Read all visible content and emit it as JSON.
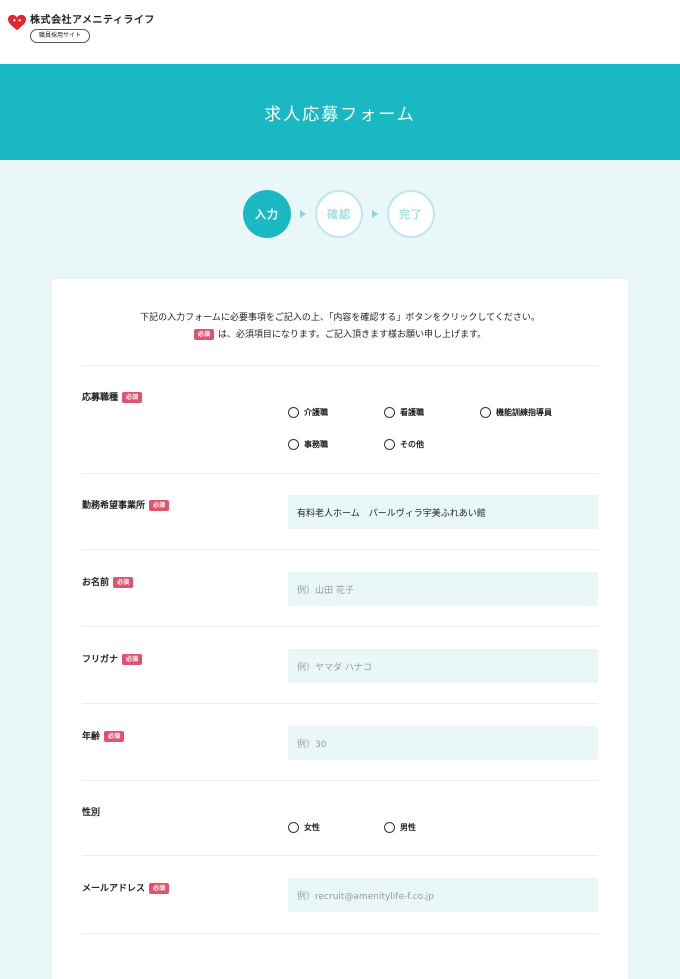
{
  "header": {
    "company_name": "株式会社アメニティライフ",
    "site_label": "職員採用サイト",
    "logo_icon": "heart-logo-icon",
    "logo_color": "#e0262f"
  },
  "banner": {
    "title": "求人応募フォーム",
    "color": "#1ab8c2"
  },
  "steps": [
    {
      "label": "入力",
      "active": true
    },
    {
      "label": "確認",
      "active": false
    },
    {
      "label": "完了",
      "active": false
    }
  ],
  "intro": {
    "line1": "下記の入力フォームに必要事項をご記入の上、「内容を確認する」ボタンをクリックしてください。",
    "line2": "は、必須項目になります。ご記入頂きます様お願い申し上げます。"
  },
  "required_badge": "必須",
  "form": {
    "job_type": {
      "label": "応募職種",
      "options": [
        "介護職",
        "看護職",
        "機能訓練指導員",
        "事務職",
        "その他"
      ]
    },
    "workplace": {
      "label": "勤務希望事業所",
      "value": "有料老人ホーム　パールヴィラ宇美ふれあい館"
    },
    "name": {
      "label": "お名前",
      "placeholder": "例）山田 花子"
    },
    "furigana": {
      "label": "フリガナ",
      "placeholder": "例）ヤマダ ハナコ"
    },
    "age": {
      "label": "年齢",
      "placeholder": "例）30"
    },
    "gender": {
      "label": "性別",
      "options": [
        "女性",
        "男性"
      ]
    },
    "email": {
      "label": "メールアドレス",
      "placeholder": "例）recruit@amenitylife-f.co.jp"
    }
  }
}
